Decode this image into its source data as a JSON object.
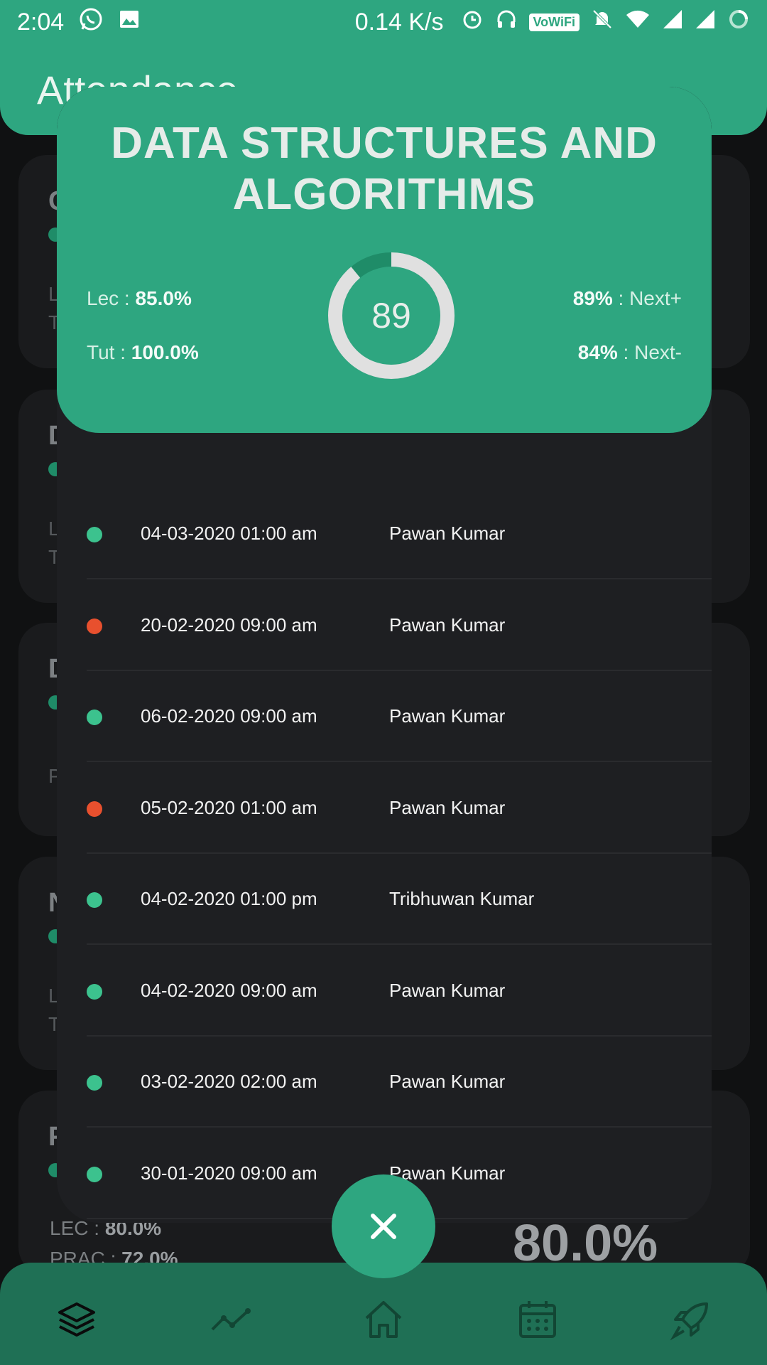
{
  "status_bar": {
    "time": "2:04",
    "net_speed": "0.14 K/s",
    "vowifi": "VoWiFi",
    "icons": [
      "whatsapp-icon",
      "gallery-icon",
      "alarm-icon",
      "headset-icon",
      "mute-icon",
      "wifi-icon",
      "signal-icon",
      "signal-icon",
      "loading-icon"
    ]
  },
  "header": {
    "title": "Attendance"
  },
  "background": {
    "cards": [
      {
        "initial": "C",
        "line1": "L",
        "line2": "T"
      },
      {
        "initial": "D",
        "line1": "L",
        "line2": "T"
      },
      {
        "initial": "D",
        "line1": "P",
        "line2": ""
      },
      {
        "initial": "N",
        "line1": "L",
        "line2": "T"
      },
      {
        "initial": "P",
        "line1": "",
        "line2": ""
      }
    ],
    "lec_label": "LEC : ",
    "lec_value": "80.0%",
    "prac_label": "PRAC : ",
    "prac_value": "72.0%",
    "big_value": "80.0%"
  },
  "dialog": {
    "subject": "DATA STRUCTURES AND ALGORITHMS",
    "lec_label": "Lec : ",
    "lec_value": "85.0%",
    "tut_label": "Tut : ",
    "tut_value": "100.0%",
    "overall": "89",
    "overall_fraction": 0.89,
    "next_plus_value": "89%",
    "next_plus_label": " : Next+",
    "next_minus_value": "84%",
    "next_minus_label": " : Next-",
    "records": [
      {
        "date": "04-03-2020 01:00 am",
        "teacher": "Pawan Kumar",
        "status": "present"
      },
      {
        "date": "20-02-2020 09:00 am",
        "teacher": "Pawan Kumar",
        "status": "absent"
      },
      {
        "date": "06-02-2020 09:00 am",
        "teacher": "Pawan Kumar",
        "status": "present"
      },
      {
        "date": "05-02-2020 01:00 am",
        "teacher": "Pawan Kumar",
        "status": "absent"
      },
      {
        "date": "04-02-2020 01:00 pm",
        "teacher": "Tribhuwan Kumar",
        "status": "present"
      },
      {
        "date": "04-02-2020 09:00 am",
        "teacher": "Pawan Kumar",
        "status": "present"
      },
      {
        "date": "03-02-2020 02:00 am",
        "teacher": "Pawan Kumar",
        "status": "present"
      },
      {
        "date": "30-01-2020 09:00 am",
        "teacher": "Pawan Kumar",
        "status": "present"
      }
    ]
  },
  "colors": {
    "accent": "#2ea680",
    "present": "#3cc28e",
    "absent": "#e8502e"
  },
  "fab": {
    "icon": "close-icon"
  },
  "bottom_nav": {
    "items": [
      "layers-icon",
      "trend-icon",
      "home-icon",
      "calendar-icon",
      "rocket-icon"
    ]
  }
}
